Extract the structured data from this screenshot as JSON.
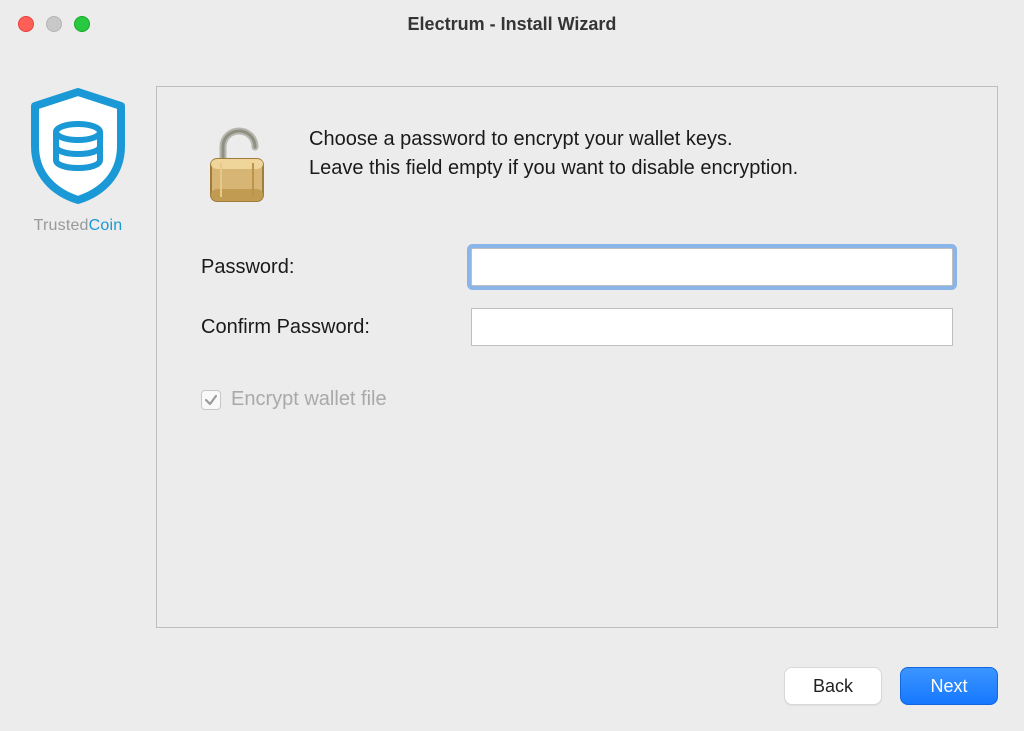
{
  "window": {
    "title": "Electrum  -  Install Wizard"
  },
  "sidebar": {
    "logo_caption_a": "Trusted",
    "logo_caption_b": "Coin"
  },
  "panel": {
    "intro_line1": "Choose a password to encrypt your wallet keys.",
    "intro_line2": "Leave this field empty if you want to disable encryption.",
    "password_label": "Password:",
    "confirm_label": "Confirm Password:",
    "password_value": "",
    "confirm_value": "",
    "encrypt_checkbox_label": "Encrypt wallet file",
    "encrypt_checkbox_checked": true,
    "encrypt_checkbox_disabled": true
  },
  "footer": {
    "back_label": "Back",
    "next_label": "Next"
  },
  "colors": {
    "accent_blue": "#1a99d6",
    "focus_ring": "#8ab5e8",
    "primary_button": "#1678ff"
  }
}
